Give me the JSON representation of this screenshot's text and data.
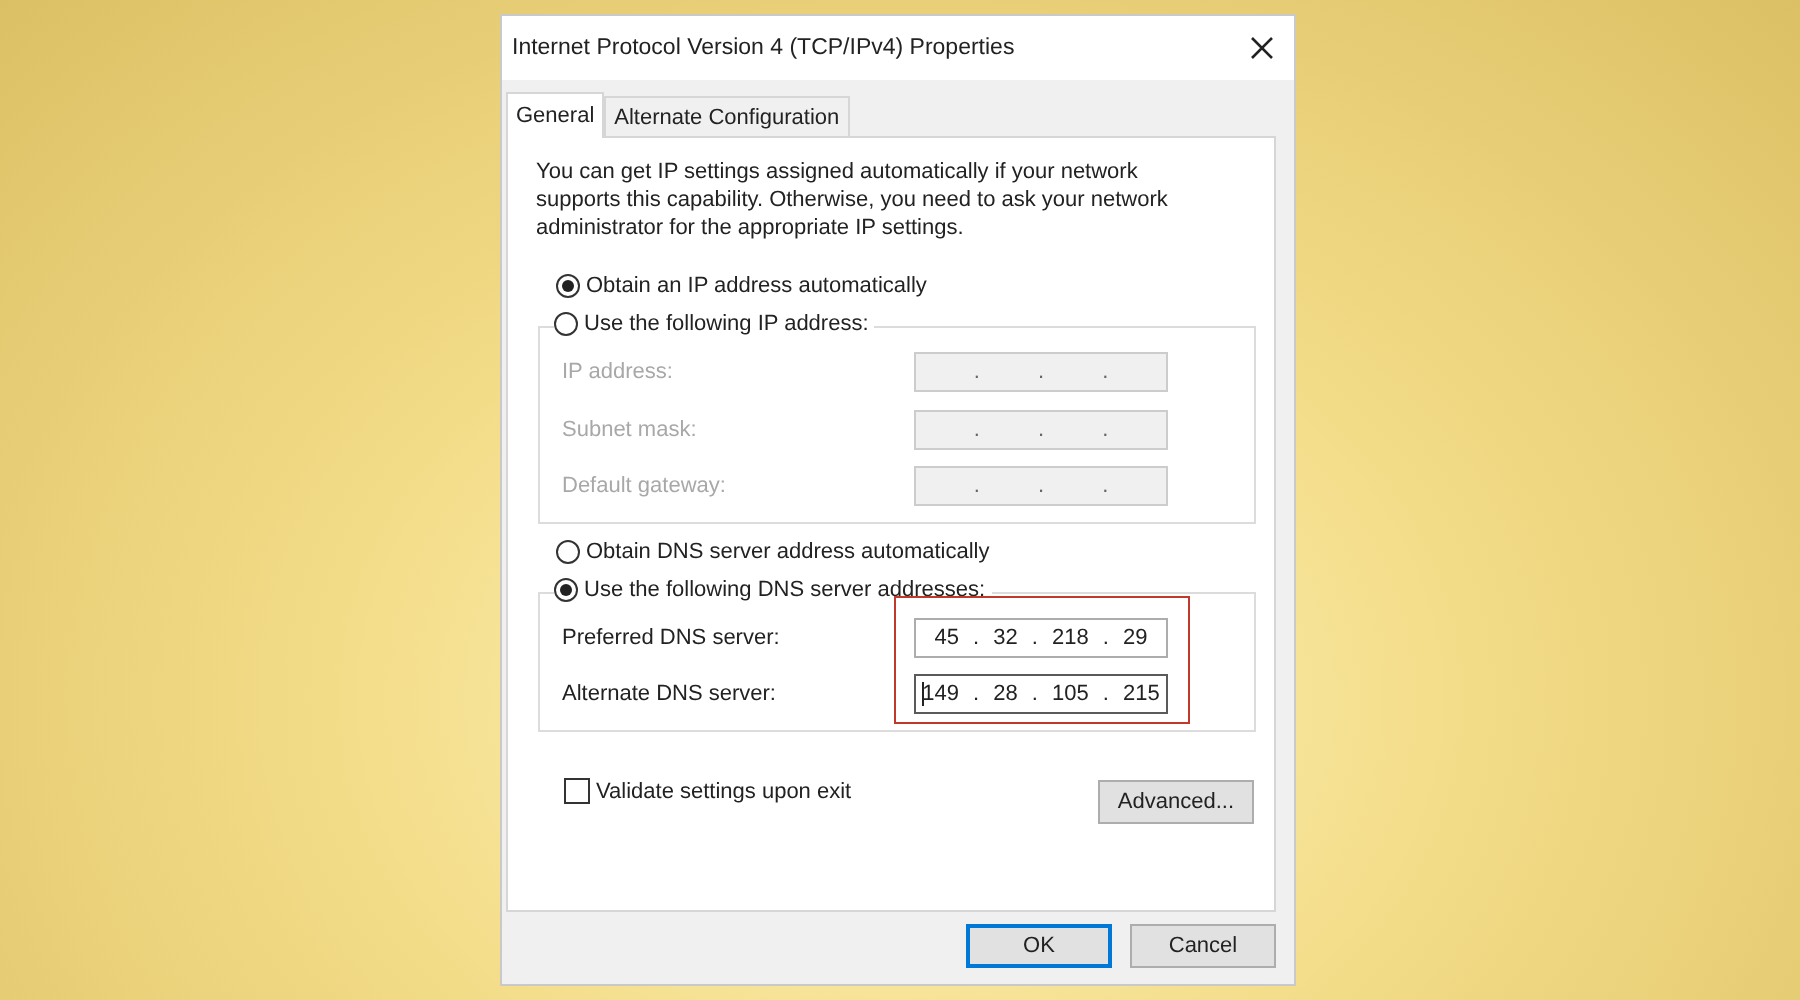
{
  "window": {
    "title": "Internet Protocol Version 4 (TCP/IPv4) Properties"
  },
  "tabs": [
    {
      "label": "General",
      "selected": true
    },
    {
      "label": "Alternate Configuration",
      "selected": false
    }
  ],
  "intro": "You can get IP settings assigned automatically if your network supports this capability. Otherwise, you need to ask your network administrator for the appropriate IP settings.",
  "ip": {
    "auto": {
      "label": "Obtain an IP address automatically",
      "selected": true
    },
    "manual": {
      "label": "Use the following IP address:",
      "selected": false
    },
    "fields": [
      {
        "label": "IP address:",
        "value": ". . .",
        "disabled": true,
        "focused": false
      },
      {
        "label": "Subnet mask:",
        "value": ". . .",
        "disabled": true,
        "focused": false
      },
      {
        "label": "Default gateway:",
        "value": ". . .",
        "disabled": true,
        "focused": false
      }
    ]
  },
  "dns": {
    "auto": {
      "label": "Obtain DNS server address automatically",
      "selected": false
    },
    "manual": {
      "label": "Use the following DNS server addresses:",
      "selected": true
    },
    "highlighted": true,
    "fields": [
      {
        "label": "Preferred DNS server:",
        "value": "45 . 32 . 218 . 29",
        "disabled": false,
        "focused": false
      },
      {
        "label": "Alternate DNS server:",
        "value": "149 . 28 . 105 . 215",
        "disabled": false,
        "focused": true
      }
    ]
  },
  "validate": {
    "label": "Validate settings upon exit",
    "checked": false
  },
  "advanced": "Advanced...",
  "buttons": [
    {
      "label": "OK",
      "default": true
    },
    {
      "label": "Cancel",
      "default": false
    }
  ]
}
